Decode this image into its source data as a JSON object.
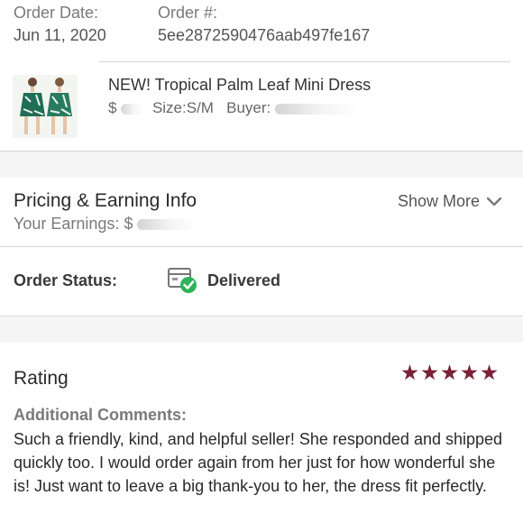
{
  "order": {
    "date_label": "Order Date:",
    "date_value": "Jun 11, 2020",
    "number_label": "Order #:",
    "number_value": "5ee2872590476aab497fe167"
  },
  "item": {
    "title": "NEW! Tropical Palm Leaf Mini Dress",
    "price_prefix": "$",
    "size_text": "Size:S/M",
    "buyer_label": "Buyer:"
  },
  "pricing": {
    "title": "Pricing & Earning Info",
    "earnings_label": "Your Earnings:",
    "earnings_prefix": "$",
    "show_more": "Show More"
  },
  "status": {
    "label": "Order Status:",
    "value": "Delivered"
  },
  "rating": {
    "title": "Rating",
    "stars": 5,
    "comments_label": "Additional Comments:",
    "comments_text": "Such a friendly, kind, and helpful seller! She responded and shipped quickly too. I would order again from her just for how wonderful she is! Just want to leave a big thank-you to her, the dress fit perfectly."
  },
  "colors": {
    "star": "#7a2237",
    "delivered_check": "#2fb35b"
  },
  "icons": [
    "package-delivered-icon",
    "chevron-down-icon",
    "star-icon"
  ]
}
